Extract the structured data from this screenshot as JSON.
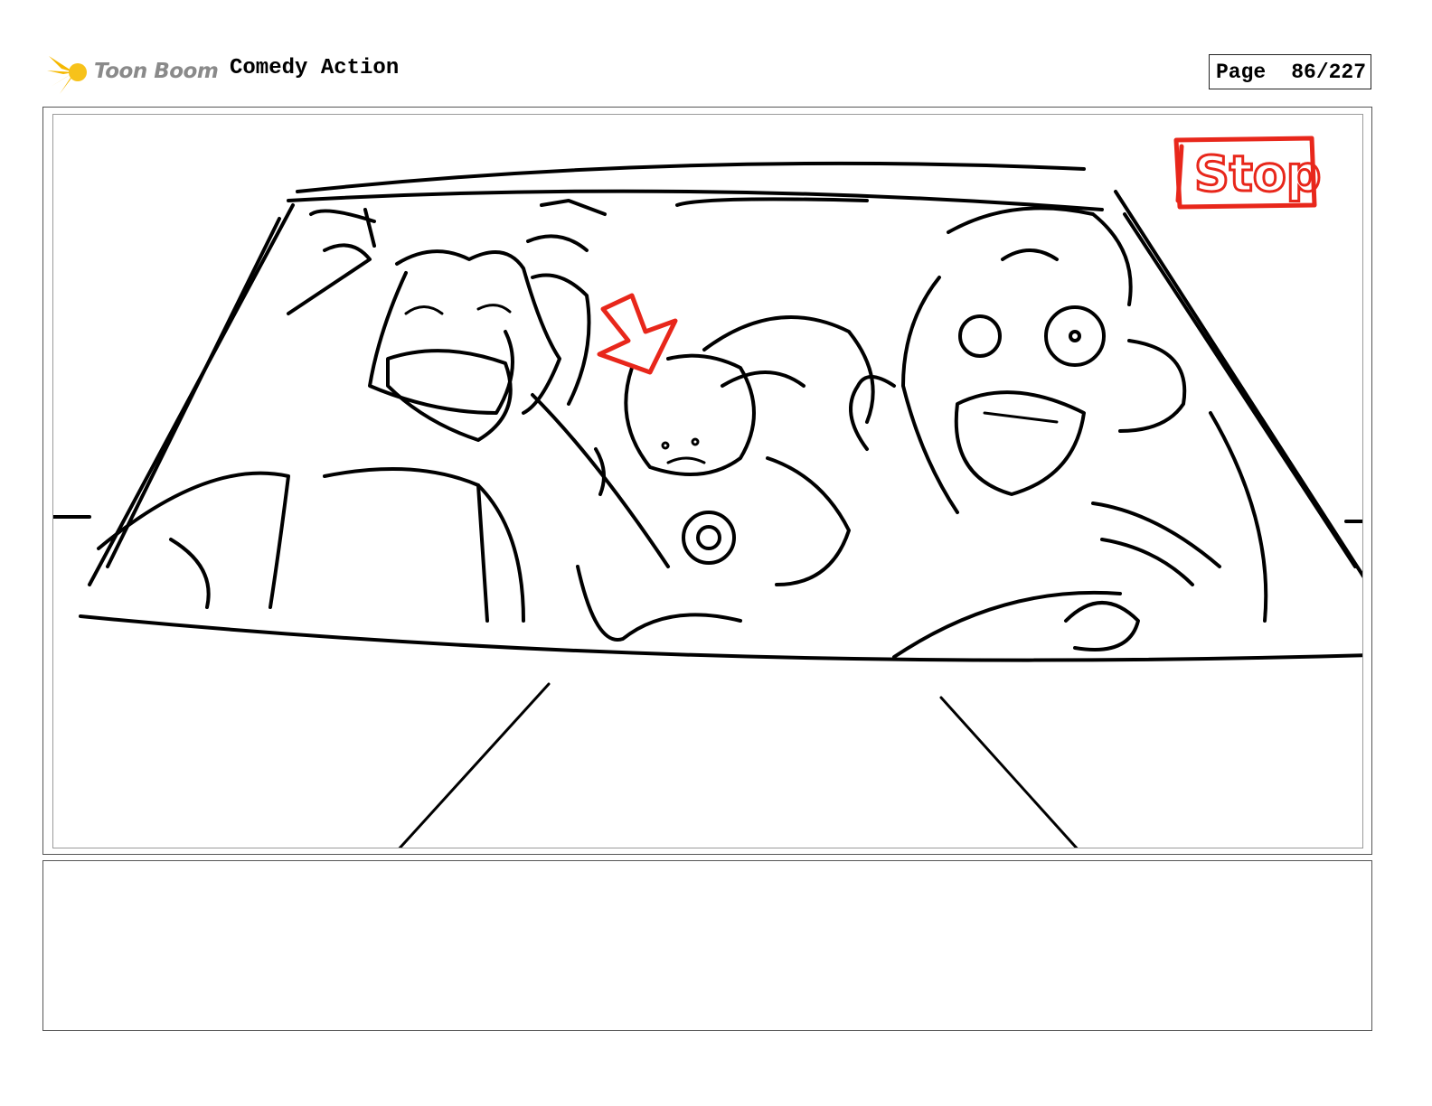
{
  "header": {
    "logo_text": "Toon Boom",
    "project_title": "Comedy Action",
    "page_label": "Page",
    "page_number": "86/227"
  },
  "panel": {
    "annotation_text": "Stop",
    "annotation_color": "#e8271b"
  },
  "caption": {
    "text": ""
  },
  "colors": {
    "logo_accent": "#f5b800",
    "logo_text": "#8a8a8a",
    "ink": "#000000"
  }
}
